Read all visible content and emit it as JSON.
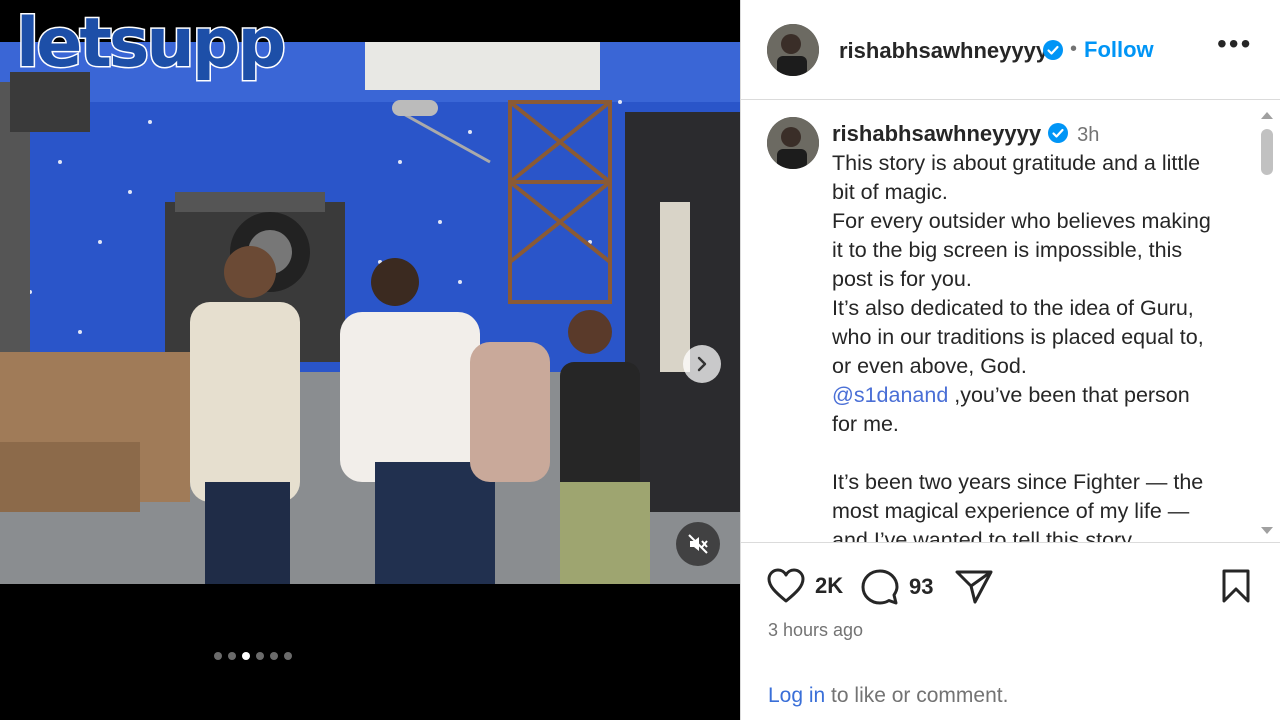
{
  "brand": {
    "logo_text": "letsupp"
  },
  "media": {
    "carousel_dots": 6,
    "active_index": 2,
    "next_icon": "chevron-right-icon",
    "mute_icon": "speaker-muted-icon"
  },
  "post": {
    "username": "rishabhsawhneyyyy",
    "separator": "•",
    "follow_label": "Follow",
    "more_label": "•••",
    "caption_time": "3h",
    "caption_lines": [
      "This story is about gratitude and a little",
      "bit of magic.",
      "For every outsider who believes making",
      "it to the big screen is impossible, this",
      "post is for you.",
      "It’s also dedicated to the idea of Guru,",
      "who in our traditions is placed equal to,",
      "or even above, God."
    ],
    "mention": "@s1danand",
    "mention_rest": " ,you’ve been that person",
    "caption_line_after_mention": "for me.",
    "caption_lines_2": [
      "It’s been two years since Fighter — the",
      "most magical experience of my life —",
      "and I’ve wanted to tell this story"
    ],
    "likes": "2K",
    "comments": "93",
    "posted_ago": "3 hours ago",
    "login_link": "Log in",
    "login_rest": " to like or comment."
  },
  "colors": {
    "accent": "#0095f6",
    "verified": "#0095f6",
    "text": "#262626",
    "muted": "#737373"
  }
}
